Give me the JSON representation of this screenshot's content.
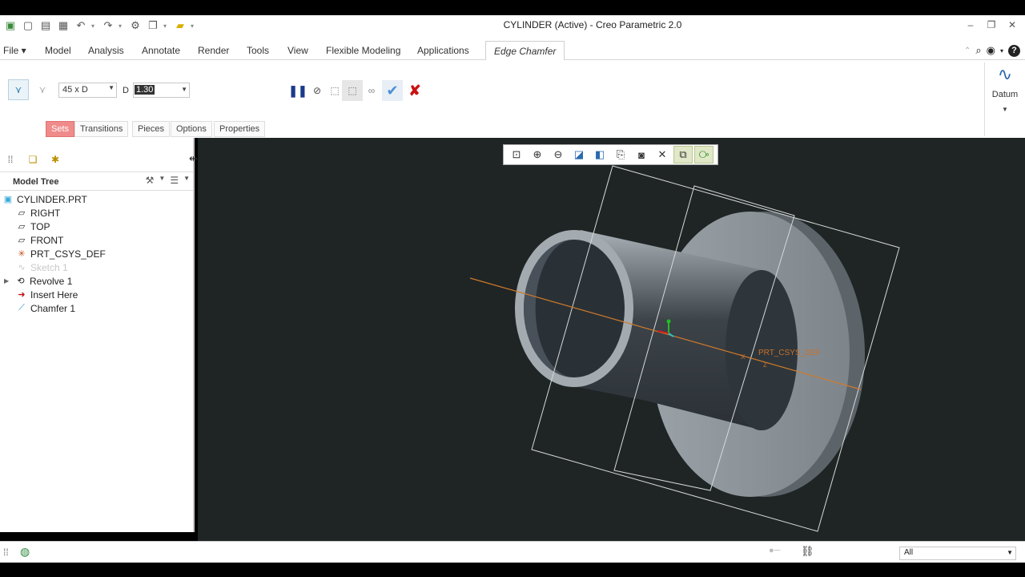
{
  "window": {
    "title": "CYLINDER (Active) - Creo Parametric 2.0"
  },
  "quick_access": [
    "new-icon",
    "open-icon",
    "save-icon",
    "undo-icon",
    "redo-icon",
    "regenerate-icon",
    "windows-icon",
    "folder-icon",
    "customize-icon"
  ],
  "menu": {
    "file": "File",
    "tabs": [
      "Model",
      "Analysis",
      "Annotate",
      "Render",
      "Tools",
      "View",
      "Flexible Modeling",
      "Applications"
    ],
    "active_tab": "Edge Chamfer"
  },
  "ribbon": {
    "scheme_value": "45 x D",
    "d_label": "D",
    "d_value": "1.30",
    "subtabs": [
      "Sets",
      "Transitions",
      "Pieces",
      "Options",
      "Properties"
    ],
    "active_subtab": "Sets",
    "datum_label": "Datum"
  },
  "model_tree": {
    "title": "Model Tree",
    "items": [
      {
        "label": "CYLINDER.PRT",
        "icon": "part-icon"
      },
      {
        "label": "RIGHT",
        "icon": "datum-plane-icon"
      },
      {
        "label": "TOP",
        "icon": "datum-plane-icon"
      },
      {
        "label": "FRONT",
        "icon": "datum-plane-icon"
      },
      {
        "label": "PRT_CSYS_DEF",
        "icon": "csys-icon"
      },
      {
        "label": "Sketch 1",
        "icon": "sketch-icon"
      },
      {
        "label": "Revolve 1",
        "icon": "revolve-icon"
      },
      {
        "label": "Insert Here",
        "icon": "insert-arrow-icon"
      },
      {
        "label": "Chamfer 1",
        "icon": "chamfer-icon"
      }
    ]
  },
  "viewport": {
    "csys_label": "PRT_CSYS_DEF",
    "axis_z": "Z",
    "axis_x": "X"
  },
  "statusbar": {
    "filter_value": "All"
  },
  "colors": {
    "viewport_bg": "#1f2525",
    "active_subtab": "#f08b8b",
    "accept_check": "#4a90d9",
    "cancel_x": "#cc1111"
  }
}
